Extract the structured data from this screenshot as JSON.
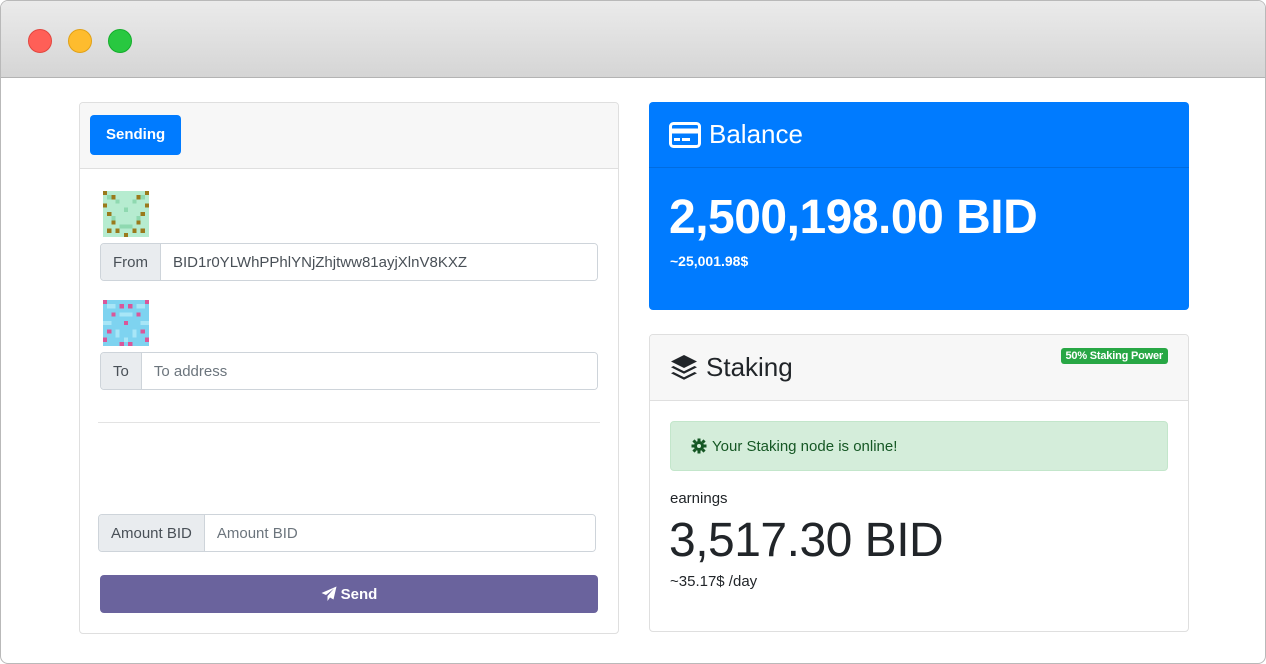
{
  "sending": {
    "tab_label": "Sending",
    "from_label": "From",
    "from_value": "BID1r0YLWhPPhlYNjZhjtww81ayjXlnV8KXZ",
    "to_label": "To",
    "to_placeholder": "To address",
    "amount_label": "Amount BID",
    "amount_placeholder": "Amount BID",
    "send_label": "Send"
  },
  "balance": {
    "title": "Balance",
    "amount": "2,500,198.00 BID",
    "usd": "~25,001.98$"
  },
  "staking": {
    "title": "Staking",
    "badge": "50% Staking Power",
    "status": "Your Staking node is online!",
    "earnings_label": "earnings",
    "earnings_amount": "3,517.30 BID",
    "earnings_rate": "~35.17$ /day"
  },
  "colors": {
    "primary": "#007bff",
    "send_button": "#6a639d",
    "success": "#28a745",
    "alert_bg": "#d4edda"
  }
}
